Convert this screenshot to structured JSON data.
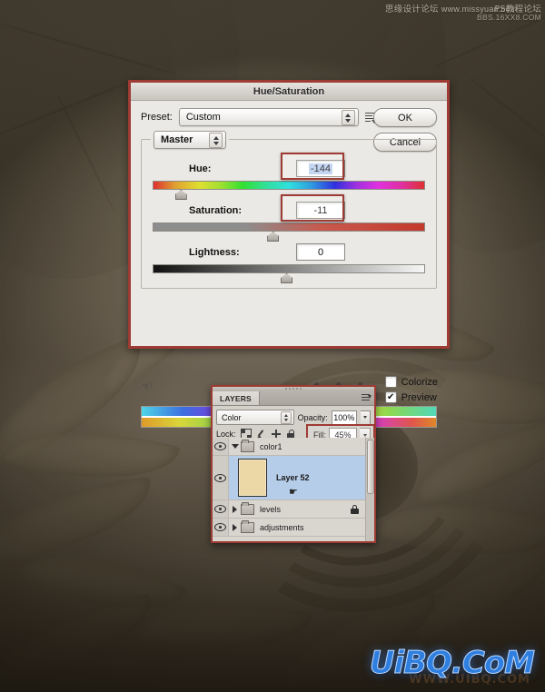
{
  "watermark": {
    "top_line1_cn": "思缘设计论坛",
    "top_line1_url": "www.missyuan.com",
    "top_right_cn": "PS教程论坛",
    "top_right_url": "BBS.16XX8.COM",
    "bottom": "UiBQ.CoM",
    "bottom_sub": "WWW.UIBQ.COM"
  },
  "hue_saturation": {
    "title": "Hue/Saturation",
    "preset_label": "Preset:",
    "preset_value": "Custom",
    "ok_label": "OK",
    "cancel_label": "Cancel",
    "channel_value": "Master",
    "sliders": [
      {
        "label": "Hue:",
        "value": "-144",
        "thumb_pct": 11,
        "selected": true
      },
      {
        "label": "Saturation:",
        "value": "-11",
        "thumb_pct": 45,
        "selected": false
      },
      {
        "label": "Lightness:",
        "value": "0",
        "thumb_pct": 50,
        "selected": false
      }
    ],
    "colorize_label": "Colorize",
    "colorize_checked": false,
    "preview_label": "Preview",
    "preview_checked": true,
    "checkmark": "✔",
    "icons": {
      "hand_target": "onscreen-adjust-icon",
      "preset_menu": "preset-menu-icon",
      "eyedropper": "eyedropper-icon",
      "eyedropper_plus": "eyedropper-plus-icon",
      "eyedropper_minus": "eyedropper-minus-icon"
    }
  },
  "layers_panel": {
    "tab_label": "LAYERS",
    "blend_mode": "Color",
    "opacity_label": "Opacity:",
    "opacity_value": "100%",
    "lock_label": "Lock:",
    "fill_label": "Fill:",
    "fill_value": "45%",
    "rows": [
      {
        "name": "color1",
        "type": "group",
        "expanded": true,
        "visible": true,
        "selected": false,
        "locked": false
      },
      {
        "name": "Layer 52",
        "type": "layer",
        "expanded": false,
        "visible": true,
        "selected": true,
        "locked": false
      },
      {
        "name": "levels",
        "type": "group",
        "expanded": false,
        "visible": true,
        "selected": false,
        "locked": true
      },
      {
        "name": "adjustments",
        "type": "group",
        "expanded": false,
        "visible": true,
        "selected": false,
        "locked": false
      }
    ],
    "icons": {
      "eye": "eye-icon",
      "lock_transparency": "lock-transparent-pixels-icon",
      "lock_image": "lock-image-pixels-icon",
      "lock_position": "lock-position-icon",
      "lock_all": "lock-all-icon",
      "padlock": "padlock-icon",
      "panel_menu": "panel-menu-icon",
      "cursor": "pointer-cursor-icon"
    }
  },
  "colors": {
    "highlight_red": "#9d3b34",
    "selection_blue": "#b6cdea",
    "thumbnail_tan": "#ecd7a6",
    "watermark_blue": "#2f7fe0"
  }
}
